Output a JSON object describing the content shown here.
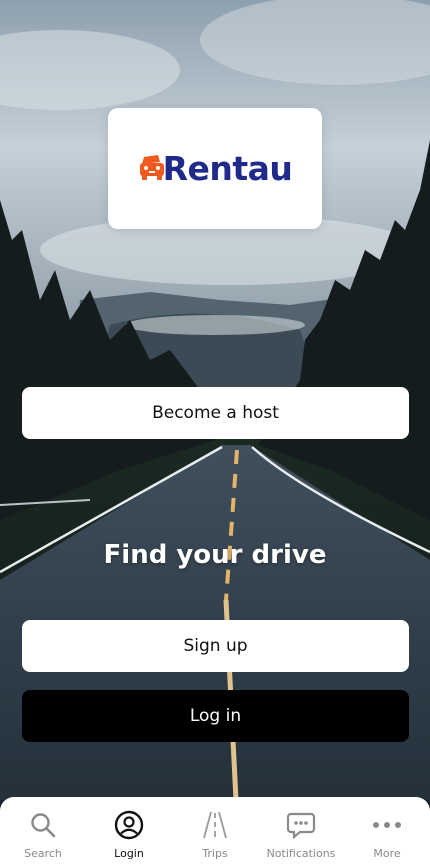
{
  "brand": {
    "name": "Rentau",
    "name_color": "#1f2a8a",
    "icon_color": "#f05a1f",
    "icon": "car-front-icon"
  },
  "actions": {
    "become_host": "Become a host",
    "headline": "Find your drive",
    "sign_up": "Sign up",
    "log_in": "Log in"
  },
  "tabbar": {
    "active": "Login",
    "items": [
      {
        "label": "Search",
        "icon": "search-icon"
      },
      {
        "label": "Login",
        "icon": "user-circle-icon"
      },
      {
        "label": "Trips",
        "icon": "road-icon"
      },
      {
        "label": "Notifications",
        "icon": "chat-bubble-icon"
      },
      {
        "label": "More",
        "icon": "more-dots-icon"
      }
    ]
  }
}
